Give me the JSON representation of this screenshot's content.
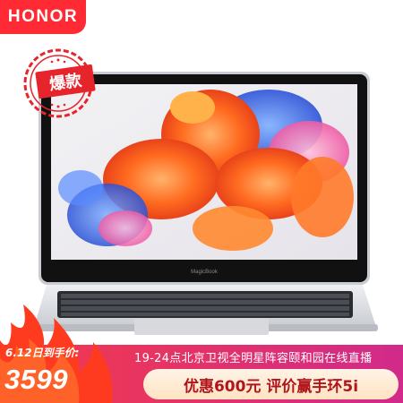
{
  "brand": {
    "logo": "HONOR",
    "color": "#ff2a33"
  },
  "stamp": {
    "label": "爆款",
    "color": "#e6242b"
  },
  "laptop": {
    "bezel_brand": "MagicBook"
  },
  "price": {
    "caption": "6.12日到手价:",
    "value": "3599"
  },
  "promo": {
    "event_line": "19-24点北京卫视全明星阵容颐和园在线直播",
    "pill": "优惠600元 评价赢手环5i"
  },
  "colors": {
    "banner": "#d72a6c",
    "flame": "#ff3b1f"
  }
}
